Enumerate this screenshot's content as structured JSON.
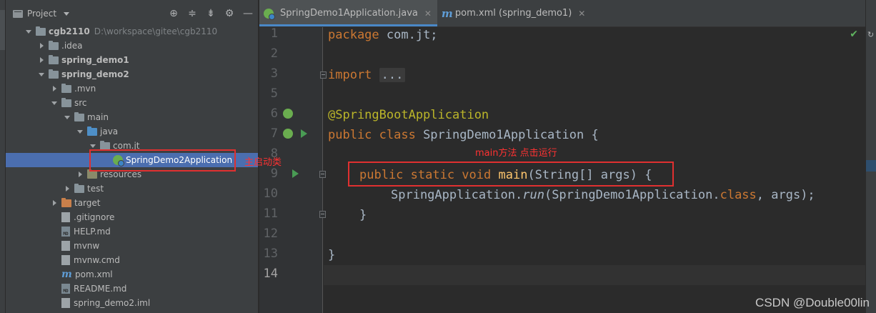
{
  "project_panel": {
    "title": "Project",
    "header_icons": [
      "crosshair-icon",
      "expand-all-icon",
      "collapse-all-icon",
      "gear-icon",
      "minimize-icon"
    ],
    "tree": [
      {
        "label": "cgb2110",
        "hint": "D:\\workspace\\gitee\\cgb2110",
        "depth": 0,
        "expanded": true,
        "kind": "module",
        "bold": true
      },
      {
        "label": ".idea",
        "depth": 1,
        "expanded": false,
        "kind": "folder"
      },
      {
        "label": "spring_demo1",
        "depth": 1,
        "expanded": false,
        "kind": "module",
        "bold": true
      },
      {
        "label": "spring_demo2",
        "depth": 1,
        "expanded": true,
        "kind": "module",
        "bold": true
      },
      {
        "label": ".mvn",
        "depth": 2,
        "expanded": false,
        "kind": "folder"
      },
      {
        "label": "src",
        "depth": 2,
        "expanded": true,
        "kind": "folder"
      },
      {
        "label": "main",
        "depth": 3,
        "expanded": true,
        "kind": "folder"
      },
      {
        "label": "java",
        "depth": 4,
        "expanded": true,
        "kind": "src"
      },
      {
        "label": "com.jt",
        "depth": 5,
        "expanded": true,
        "kind": "package"
      },
      {
        "label": "SpringDemo2Application",
        "depth": 6,
        "kind": "spring",
        "selected": true
      },
      {
        "label": "resources",
        "depth": 4,
        "expanded": false,
        "kind": "res"
      },
      {
        "label": "test",
        "depth": 3,
        "expanded": false,
        "kind": "folder"
      },
      {
        "label": "target",
        "depth": 2,
        "expanded": false,
        "kind": "target"
      },
      {
        "label": ".gitignore",
        "depth": 2,
        "kind": "file"
      },
      {
        "label": "HELP.md",
        "depth": 2,
        "kind": "md"
      },
      {
        "label": "mvnw",
        "depth": 2,
        "kind": "file"
      },
      {
        "label": "mvnw.cmd",
        "depth": 2,
        "kind": "file"
      },
      {
        "label": "pom.xml",
        "depth": 2,
        "kind": "maven"
      },
      {
        "label": "README.md",
        "depth": 2,
        "kind": "md"
      },
      {
        "label": "spring_demo2.iml",
        "depth": 2,
        "kind": "file"
      }
    ],
    "annotation": "主启动类"
  },
  "editor": {
    "tabs": [
      {
        "label": "SpringDemo1Application.java",
        "icon": "spring-icon",
        "active": true
      },
      {
        "label": "pom.xml (spring_demo1)",
        "icon": "maven-icon",
        "active": false
      }
    ],
    "line_numbers": [
      "1",
      "2",
      "3",
      "5",
      "6",
      "7",
      "8",
      "9",
      "10",
      "11",
      "12",
      "13",
      "14"
    ],
    "code": {
      "l1_kw": "package",
      "l1_rest": " com.jt;",
      "l3_kw": "import",
      "l3_fold": "...",
      "l6_ann": "@SpringBootApplication",
      "l7_kw": "public class",
      "l7_rest": " SpringDemo1Application {",
      "l9_kw": "public static void",
      "l9_fn": "main",
      "l9_rest": "(String[] args) {",
      "l10_a": "SpringApplication.",
      "l10_run": "run",
      "l10_b": "(SpringDemo1Application.",
      "l10_kw": "class",
      "l10_c": ", args);",
      "l11": "}",
      "l13": "}"
    },
    "annotation": "main方法  点击运行",
    "watermark": "CSDN @Double00lin"
  }
}
